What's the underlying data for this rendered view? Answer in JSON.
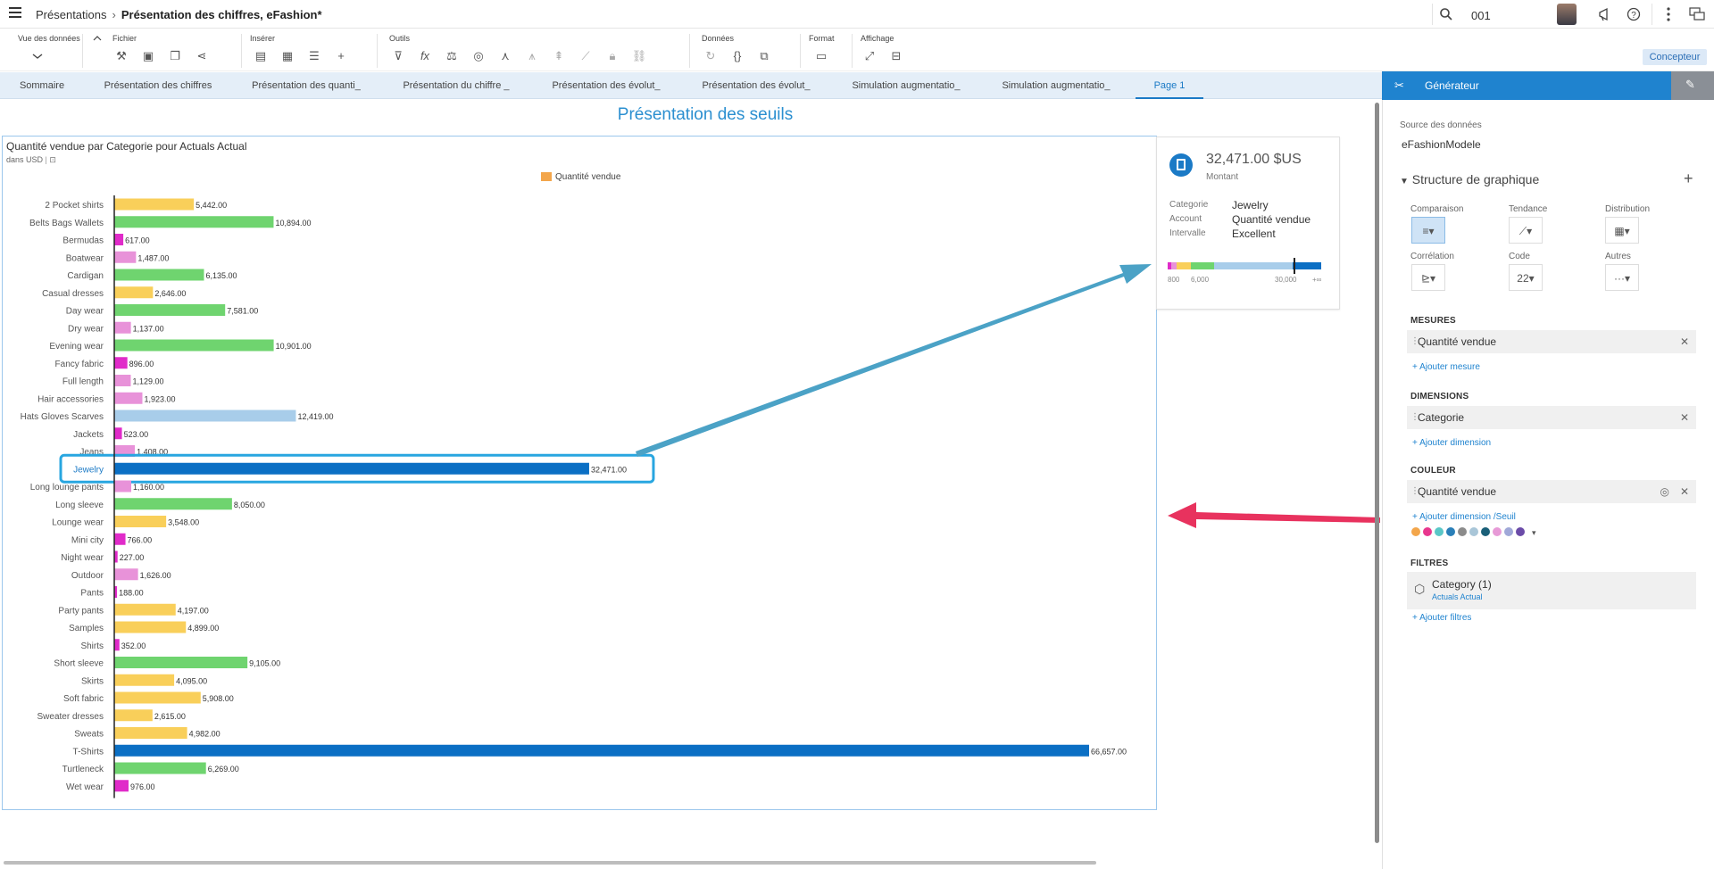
{
  "header": {
    "breadcrumb_root": "Présentations",
    "breadcrumb_sep": "›",
    "document_title": "Présentation des chiffres, eFashion*",
    "search_value": "001"
  },
  "toolbar": {
    "groups": [
      {
        "label": "Vue des données"
      },
      {
        "label": "Fichier"
      },
      {
        "label": "Insérer"
      },
      {
        "label": "Outils"
      },
      {
        "label": "Données"
      },
      {
        "label": "Format"
      },
      {
        "label": "Affichage"
      }
    ],
    "concepteur_label": "Concepteur"
  },
  "tabs": [
    {
      "label": "Sommaire"
    },
    {
      "label": "Présentation des chiffres"
    },
    {
      "label": "Présentation des quanti_"
    },
    {
      "label": "Présentation du chiffre _"
    },
    {
      "label": "Présentation des évolut_"
    },
    {
      "label": "Présentation des évolut_"
    },
    {
      "label": "Simulation augmentatio_"
    },
    {
      "label": "Simulation augmentatio_"
    },
    {
      "label": "Page 1",
      "active": true
    }
  ],
  "page": {
    "title": "Présentation des seuils"
  },
  "chart": {
    "title": "Quantité vendue par Categorie pour Actuals Actual",
    "subtitle": "dans USD"
  },
  "chart_data": {
    "type": "bar",
    "orientation": "horizontal",
    "title": "Quantité vendue par Categorie pour Actuals Actual",
    "subtitle": "dans USD",
    "legend": [
      "Quantité vendue"
    ],
    "legend_placement": "top",
    "grid": false,
    "xlim": [
      0,
      66657
    ],
    "categories": [
      "2 Pocket shirts",
      "Belts Bags Wallets",
      "Bermudas",
      "Boatwear",
      "Cardigan",
      "Casual dresses",
      "Day wear",
      "Dry wear",
      "Evening wear",
      "Fancy fabric",
      "Full length",
      "Hair accessories",
      "Hats Gloves Scarves",
      "Jackets",
      "Jeans",
      "Jewelry",
      "Long lounge pants",
      "Long sleeve",
      "Lounge wear",
      "Mini city",
      "Night wear",
      "Outdoor",
      "Pants",
      "Party pants",
      "Samples",
      "Shirts",
      "Short sleeve",
      "Skirts",
      "Soft fabric",
      "Sweater dresses",
      "Sweats",
      "T-Shirts",
      "Turtleneck",
      "Wet wear"
    ],
    "values": [
      5442,
      10894,
      617,
      1487,
      6135,
      2646,
      7581,
      1137,
      10901,
      896,
      1129,
      1923,
      12419,
      523,
      1408,
      32471,
      1160,
      8050,
      3548,
      766,
      227,
      1626,
      188,
      4197,
      4899,
      352,
      9105,
      4095,
      5908,
      2615,
      4982,
      66657,
      6269,
      976
    ],
    "value_labels": [
      "5,442.00",
      "10,894.00",
      "617.00",
      "1,487.00",
      "6,135.00",
      "2,646.00",
      "7,581.00",
      "1,137.00",
      "10,901.00",
      "896.00",
      "1,129.00",
      "1,923.00",
      "12,419.00",
      "523.00",
      "1,408.00",
      "32,471.00",
      "1,160.00",
      "8,050.00",
      "3,548.00",
      "766.00",
      "227.00",
      "1,626.00",
      "188.00",
      "4,197.00",
      "4,899.00",
      "352.00",
      "9,105.00",
      "4,095.00",
      "5,908.00",
      "2,615.00",
      "4,982.00",
      "66,657.00",
      "6,269.00",
      "976.00"
    ],
    "threshold_colors": {
      "below_1000": "#e02bc9",
      "1000_2000": "#e892d9",
      "2000_6000": "#f9cf5a",
      "6000_12000": "#6fd46f",
      "12000_30000": "#a8cdea",
      "above_30000": "#0b6fc4"
    },
    "highlight_category": "Jewelry",
    "highlight_color": "#28a6e0"
  },
  "kpi": {
    "amount": "32,471.00 $US",
    "amount_label": "Montant",
    "rows": [
      {
        "key": "Categorie",
        "value": "Jewelry"
      },
      {
        "key": "Account",
        "value": "Quantité vendue"
      },
      {
        "key": "Intervalle",
        "value": "Excellent"
      }
    ],
    "scale_labels": [
      "800",
      "6,000",
      "30,000",
      "+∞"
    ]
  },
  "annotations": {
    "arrow1_color": "#4aa3c4",
    "arrow2_color": "#e8325e",
    "box_color": "#e03040"
  },
  "panel": {
    "title": "Générateur",
    "source_label": "Source des données",
    "source_value": "eFashionModele",
    "structure_label": "Structure de graphique",
    "chart_types": [
      {
        "label": "Comparaison"
      },
      {
        "label": "Tendance"
      },
      {
        "label": "Distribution"
      },
      {
        "label": "Corrélation"
      },
      {
        "label": "Code"
      },
      {
        "label": "Autres"
      }
    ],
    "code_value": "22",
    "measures_label": "MESURES",
    "measure_item": "Quantité vendue",
    "add_measure": "+ Ajouter mesure",
    "dimensions_label": "DIMENSIONS",
    "dimension_item": "Categorie",
    "add_dimension": "+ Ajouter dimension",
    "color_label": "COULEUR",
    "color_item": "Quantité vendue",
    "add_threshold": "+ Ajouter dimension /Seuil",
    "palette": [
      "#f3a64b",
      "#e8378e",
      "#5ac7c7",
      "#2a7fb8",
      "#8b8b8b",
      "#a9c6d8",
      "#1a5f78",
      "#e79ad7",
      "#a0a8d8",
      "#6b4ba8"
    ],
    "filters_label": "FILTRES",
    "filter_name": "Category (1)",
    "filter_value": "Actuals Actual",
    "add_filter": "+ Ajouter filtres"
  }
}
